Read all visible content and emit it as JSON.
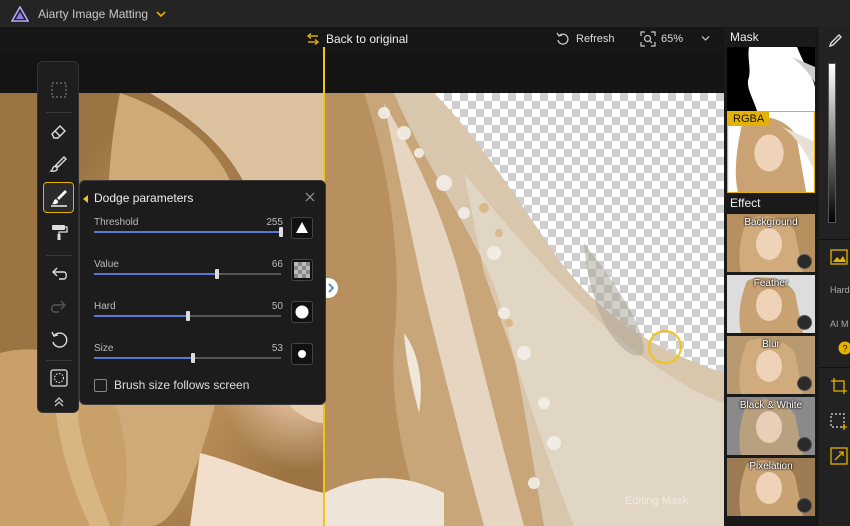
{
  "app": {
    "title": "Aiarty Image Matting"
  },
  "canvas_toolbar": {
    "back_to_original": "Back to original",
    "refresh": "Refresh",
    "zoom": "65%"
  },
  "tools": [
    {
      "name": "select-tool",
      "icon": "marquee-icon"
    },
    {
      "name": "eraser-tool",
      "icon": "eraser-icon"
    },
    {
      "name": "brush-tool",
      "icon": "brush-icon"
    },
    {
      "name": "dodge-tool",
      "icon": "dodge-brush-icon",
      "active": true
    },
    {
      "name": "paint-roller-tool",
      "icon": "paint-roller-icon"
    },
    {
      "name": "undo-button",
      "icon": "undo-icon"
    },
    {
      "name": "redo-button",
      "icon": "redo-icon"
    },
    {
      "name": "reset-button",
      "icon": "reset-icon"
    },
    {
      "name": "circle-select-tool",
      "icon": "circle-select-icon"
    },
    {
      "name": "collapse-button",
      "icon": "double-chevron-up-icon"
    }
  ],
  "dodge_panel": {
    "title": "Dodge parameters",
    "params": [
      {
        "label": "Threshold",
        "value": "255",
        "fraction": 1.0,
        "shape": "triangle"
      },
      {
        "label": "Value",
        "value": "66",
        "fraction": 0.66,
        "shape": "checker"
      },
      {
        "label": "Hard",
        "value": "50",
        "fraction": 0.5,
        "shape": "circle"
      },
      {
        "label": "Size",
        "value": "53",
        "fraction": 0.53,
        "shape": "dot"
      }
    ],
    "follow_screen_label": "Brush size follows screen",
    "follow_screen_checked": false
  },
  "overlay": {
    "editing_mask": "Editing Mask"
  },
  "right_panel": {
    "mask_label": "Mask",
    "rgba_label": "RGBA",
    "effect_label": "Effect",
    "effects": [
      "Background",
      "Feather",
      "Blur",
      "Black & White",
      "Pixelation"
    ]
  },
  "far_panel": {
    "text1": "Hard",
    "text2": "AI M"
  },
  "colors": {
    "accent": "#e5b200",
    "slider_fill": "#5a78d0"
  }
}
